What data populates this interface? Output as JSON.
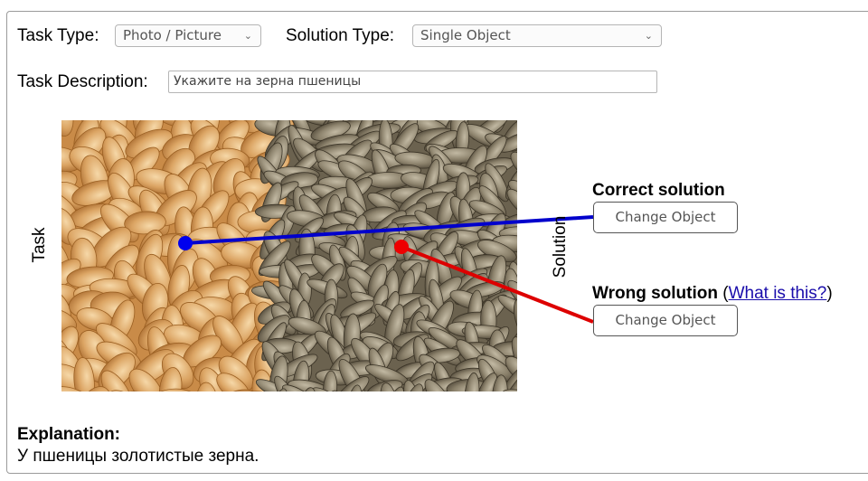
{
  "task_type": {
    "label": "Task Type:",
    "value": "Photo / Picture"
  },
  "solution_type": {
    "label": "Solution Type:",
    "value": "Single Object"
  },
  "task_description": {
    "label": "Task Description:",
    "value": "Укажите на зерна пшеницы"
  },
  "image": {
    "left_label": "Task",
    "right_label": "Solution"
  },
  "correct_solution": {
    "title": "Correct solution",
    "button": "Change Object",
    "color": "#0000dd"
  },
  "wrong_solution": {
    "title": "Wrong solution",
    "paren_open": "(",
    "link": "What is this?",
    "paren_close": ")",
    "button": "Change Object",
    "color": "#e00000"
  },
  "explanation": {
    "title": "Explanation:",
    "text": "У пшеницы золотистые зерна."
  },
  "icons": {
    "dropdown": "chevron-down-icon"
  }
}
